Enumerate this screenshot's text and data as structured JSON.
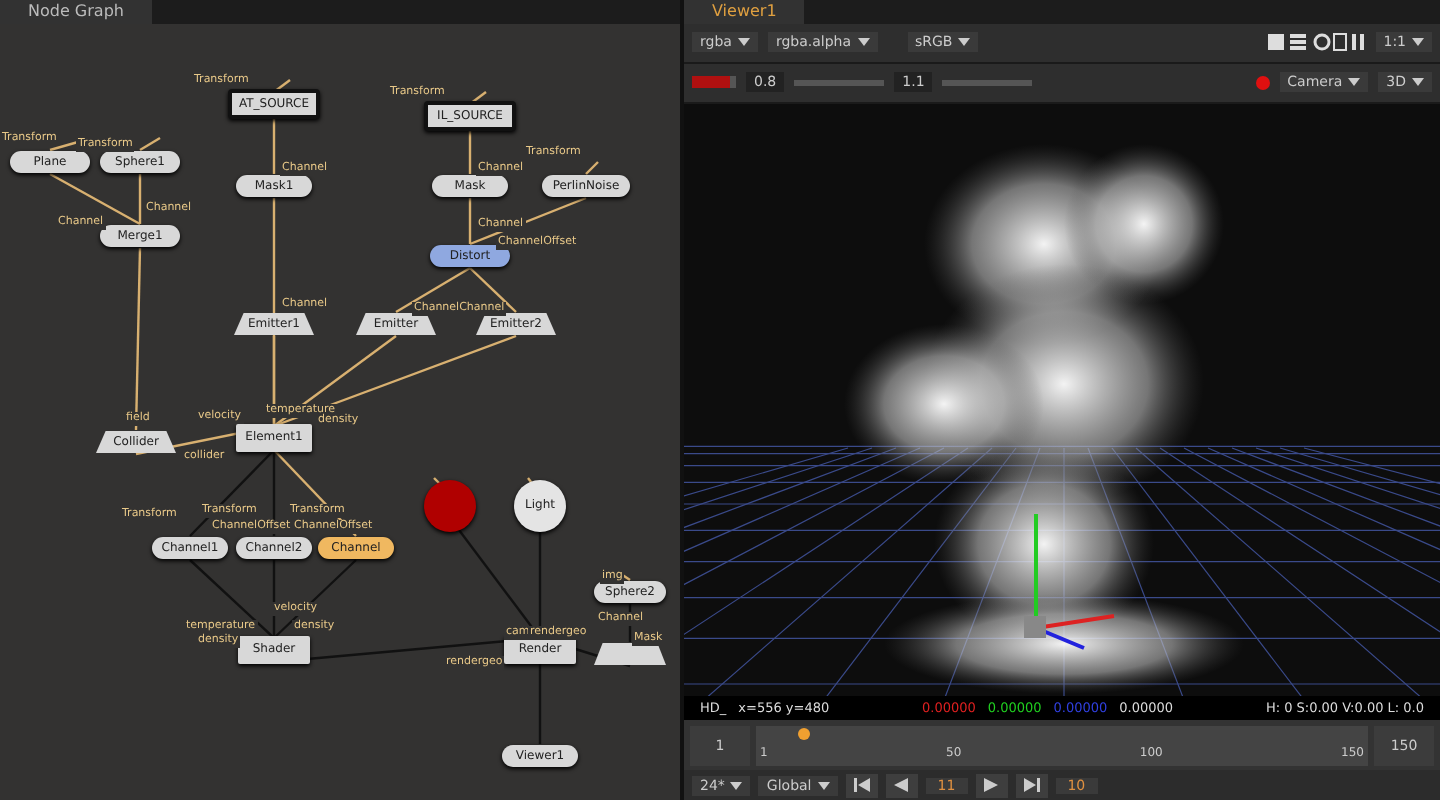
{
  "node_graph": {
    "title": "Node Graph",
    "nodes": [
      {
        "label": "Plane",
        "kind": "pill",
        "color": "#d8d8d8"
      },
      {
        "label": "Sphere1",
        "kind": "pill",
        "color": "#d8d8d8"
      },
      {
        "label": "Merge1",
        "kind": "pill",
        "color": "#d8d8d8"
      },
      {
        "label": "AT_SOURCE",
        "kind": "source",
        "color": "#d8d8d8"
      },
      {
        "label": "Mask1",
        "kind": "pill",
        "color": "#d8d8d8"
      },
      {
        "label": "IL_SOURCE",
        "kind": "source",
        "color": "#d8d8d8"
      },
      {
        "label": "Mask",
        "kind": "pill",
        "color": "#d8d8d8"
      },
      {
        "label": "PerlinNoise",
        "kind": "pill",
        "color": "#d8d8d8"
      },
      {
        "label": "Distort",
        "kind": "pill",
        "color": "#8fa8e0"
      },
      {
        "label": "Emitter1",
        "kind": "trap",
        "color": "#d8d8d8"
      },
      {
        "label": "Emitter",
        "kind": "trap",
        "color": "#d8d8d8"
      },
      {
        "label": "Emitter2",
        "kind": "trap",
        "color": "#d8d8d8"
      },
      {
        "label": "Collider",
        "kind": "trap",
        "color": "#d8d8d8"
      },
      {
        "label": "Element1",
        "kind": "rect",
        "color": "#d8d8d8"
      },
      {
        "kind": "circle",
        "color": "#b00000"
      },
      {
        "label": "Light",
        "kind": "circle",
        "color": "#e4e4e4"
      },
      {
        "label": "Channel1",
        "kind": "pill",
        "color": "#d8d8d8"
      },
      {
        "label": "Channel2",
        "kind": "pill",
        "color": "#d8d8d8"
      },
      {
        "label": "Channel",
        "kind": "pill",
        "color": "#f0b860"
      },
      {
        "label": "Shader",
        "kind": "rect",
        "color": "#d8d8d8"
      },
      {
        "label": "Render",
        "kind": "rect",
        "color": "#d8d8d8"
      },
      {
        "label": "Sphere2",
        "kind": "pill",
        "color": "#d8d8d8"
      },
      {
        "kind": "trap",
        "color": "#d8d8d8"
      },
      {
        "label": "Viewer1",
        "kind": "pill",
        "color": "#d8d8d8"
      }
    ],
    "port_labels": [
      "Transform",
      "Transform",
      "Channel",
      "Channel",
      "Transform",
      "Channel",
      "Transform",
      "Channel",
      "Transform",
      "Channel",
      "ChannelOffset",
      "Channel",
      "ChannelChannel",
      "field",
      "velocity",
      "temperature",
      "density",
      "collider",
      "Transform",
      "Transform",
      "ChannelOffset",
      "Transform",
      "ChannelOffset",
      "temperature",
      "density",
      "velocity",
      "density",
      "cam",
      "rendergeo",
      "Channel",
      "Mask",
      "rendergeo",
      "img"
    ]
  },
  "viewer": {
    "title": "Viewer1",
    "toolbar_1": {
      "channels": "rgba",
      "layer": "rgba.alpha",
      "colorspace": "sRGB",
      "zoom": "1:1"
    },
    "toolbar_2": {
      "exposure": {
        "level": 0.85
      },
      "gain": "0.8",
      "gamma": "1.1",
      "camera": "Camera",
      "mode": "3D"
    },
    "status": {
      "format": "HD_",
      "coords": "x=556 y=480",
      "r": "0.00000",
      "g": "0.00000",
      "b": "0.00000",
      "a": "0.00000",
      "hsvl": "H: 0 S:0.00 V:0.00 L: 0.0"
    },
    "timeline": {
      "start": "1",
      "ticks": [
        "1",
        "50",
        "100",
        "150"
      ],
      "end": "150",
      "level": 0.07,
      "fps": "24*",
      "scope": "Global",
      "frame": "11",
      "step": "10"
    }
  }
}
